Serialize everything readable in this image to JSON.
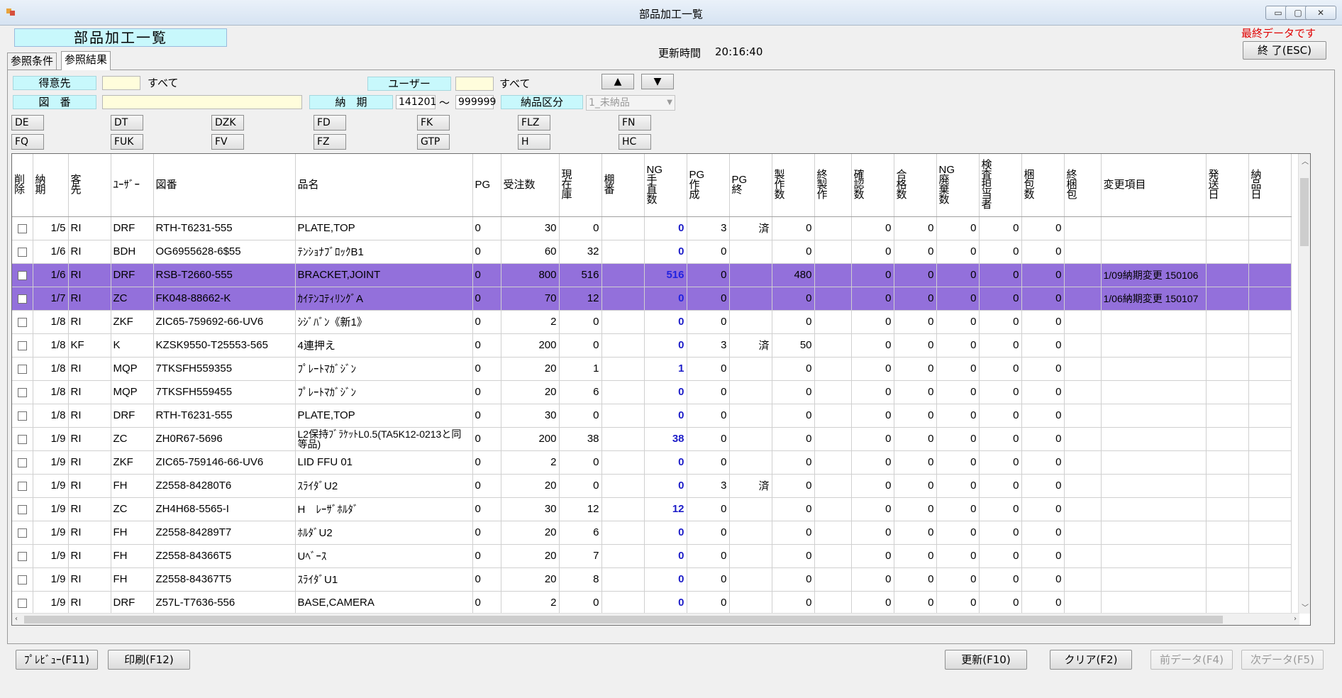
{
  "window": {
    "title": "部品加工一覧"
  },
  "header": {
    "label": "部品加工一覧",
    "update_label": "更新時間",
    "update_time": "20:16:40",
    "last_data": "最終データです",
    "exit_button": "終 了(ESC)"
  },
  "tabs": [
    "参照条件",
    "参照結果"
  ],
  "filters": {
    "customer_label": "得意先",
    "customer_value": "",
    "customer_all": "すべて",
    "user_label": "ユーザー",
    "user_value": "",
    "user_all": "すべて",
    "drawing_label": "図　番",
    "drawing_value": "",
    "due_label": "納　期",
    "due_from": "141201",
    "due_tilde": "～",
    "due_to": "999999",
    "delivery_label": "納品区分",
    "delivery_value": "1_未納品",
    "up_arrow": "▲",
    "down_arrow": "▼"
  },
  "codes_row1": [
    "DE",
    "DT",
    "DZK",
    "FD",
    "FK",
    "FLZ",
    "FN"
  ],
  "codes_row2": [
    "FQ",
    "FUK",
    "FV",
    "FZ",
    "GTP",
    "H",
    "HC"
  ],
  "table": {
    "columns": [
      "削\n除",
      "納\n期",
      "客\n先",
      "ﾕｰｻﾞｰ",
      "図番",
      "品名",
      "PG",
      "受注数",
      "現\n在\n庫",
      "棚\n番",
      "NG\n手\n直\n数",
      "PG\n作\n成",
      "PG\n終",
      "製\n作\n数",
      "終\n製\n作",
      "確\n認\n数",
      "合\n格\n数",
      "NG\n廃\n棄\n数",
      "検\n査\n担\n当\n者",
      "梱\n包\n数",
      "終\n梱\n包",
      "変更項目",
      "発\n送\n日",
      "納\n品\n日"
    ],
    "rows": [
      {
        "due": "1/5",
        "cust": "RI",
        "user": "DRF",
        "drawing": "RTH-T6231-555",
        "name": "PLATE,TOP",
        "pg": "0",
        "order": "30",
        "stock": "0",
        "shelf": "",
        "ng": "0",
        "pgmake": "3",
        "pgend": "済",
        "make": "0",
        "endmake": "",
        "confirm": "0",
        "pass": "0",
        "ngdisp": "0",
        "insp": "0",
        "pack": "0",
        "endpack": "",
        "change": "",
        "ship": "",
        "deliv": "",
        "hl": false
      },
      {
        "due": "1/6",
        "cust": "RI",
        "user": "BDH",
        "drawing": "OG6955628-6$55",
        "name": "ﾃﾝｼｮﾅﾌﾞﾛｯｸB1",
        "pg": "0",
        "order": "60",
        "stock": "32",
        "shelf": "",
        "ng": "0",
        "pgmake": "0",
        "pgend": "",
        "make": "0",
        "endmake": "",
        "confirm": "0",
        "pass": "0",
        "ngdisp": "0",
        "insp": "0",
        "pack": "0",
        "endpack": "",
        "change": "",
        "ship": "",
        "deliv": "",
        "hl": false
      },
      {
        "due": "1/6",
        "cust": "RI",
        "user": "DRF",
        "drawing": "RSB-T2660-555",
        "name": "BRACKET,JOINT",
        "pg": "0",
        "order": "800",
        "stock": "516",
        "shelf": "",
        "ng": "516",
        "pgmake": "0",
        "pgend": "",
        "make": "480",
        "endmake": "",
        "confirm": "0",
        "pass": "0",
        "ngdisp": "0",
        "insp": "0",
        "pack": "0",
        "endpack": "",
        "change": "1/09納期変更 150106",
        "ship": "",
        "deliv": "",
        "hl": true
      },
      {
        "due": "1/7",
        "cust": "RI",
        "user": "ZC",
        "drawing": "FK048-88662-K",
        "name": "ｶｲﾃﾝｺﾃｨﾘﾝｸﾞA",
        "pg": "0",
        "order": "70",
        "stock": "12",
        "shelf": "",
        "ng": "0",
        "pgmake": "0",
        "pgend": "",
        "make": "0",
        "endmake": "",
        "confirm": "0",
        "pass": "0",
        "ngdisp": "0",
        "insp": "0",
        "pack": "0",
        "endpack": "",
        "change": "1/06納期変更 150107",
        "ship": "",
        "deliv": "",
        "hl": true
      },
      {
        "due": "1/8",
        "cust": "RI",
        "user": "ZKF",
        "drawing": "ZIC65-759692-66-UV6",
        "name": "ｼｼﾞﾊﾞﾝ《新1》",
        "pg": "0",
        "order": "2",
        "stock": "0",
        "shelf": "",
        "ng": "0",
        "pgmake": "0",
        "pgend": "",
        "make": "0",
        "endmake": "",
        "confirm": "0",
        "pass": "0",
        "ngdisp": "0",
        "insp": "0",
        "pack": "0",
        "endpack": "",
        "change": "",
        "ship": "",
        "deliv": "",
        "hl": false
      },
      {
        "due": "1/8",
        "cust": "KF",
        "user": "K",
        "drawing": "KZSK9550-T25553-565",
        "name": "4連押え",
        "pg": "0",
        "order": "200",
        "stock": "0",
        "shelf": "",
        "ng": "0",
        "pgmake": "3",
        "pgend": "済",
        "make": "50",
        "endmake": "",
        "confirm": "0",
        "pass": "0",
        "ngdisp": "0",
        "insp": "0",
        "pack": "0",
        "endpack": "",
        "change": "",
        "ship": "",
        "deliv": "",
        "hl": false
      },
      {
        "due": "1/8",
        "cust": "RI",
        "user": "MQP",
        "drawing": "7TKSFH559355",
        "name": "ﾌﾟﾚｰﾄﾏｶﾞｼﾞﾝ",
        "pg": "0",
        "order": "20",
        "stock": "1",
        "shelf": "",
        "ng": "1",
        "pgmake": "0",
        "pgend": "",
        "make": "0",
        "endmake": "",
        "confirm": "0",
        "pass": "0",
        "ngdisp": "0",
        "insp": "0",
        "pack": "0",
        "endpack": "",
        "change": "",
        "ship": "",
        "deliv": "",
        "hl": false
      },
      {
        "due": "1/8",
        "cust": "RI",
        "user": "MQP",
        "drawing": "7TKSFH559455",
        "name": "ﾌﾟﾚｰﾄﾏｶﾞｼﾞﾝ",
        "pg": "0",
        "order": "20",
        "stock": "6",
        "shelf": "",
        "ng": "0",
        "pgmake": "0",
        "pgend": "",
        "make": "0",
        "endmake": "",
        "confirm": "0",
        "pass": "0",
        "ngdisp": "0",
        "insp": "0",
        "pack": "0",
        "endpack": "",
        "change": "",
        "ship": "",
        "deliv": "",
        "hl": false
      },
      {
        "due": "1/8",
        "cust": "RI",
        "user": "DRF",
        "drawing": "RTH-T6231-555",
        "name": "PLATE,TOP",
        "pg": "0",
        "order": "30",
        "stock": "0",
        "shelf": "",
        "ng": "0",
        "pgmake": "0",
        "pgend": "",
        "make": "0",
        "endmake": "",
        "confirm": "0",
        "pass": "0",
        "ngdisp": "0",
        "insp": "0",
        "pack": "0",
        "endpack": "",
        "change": "",
        "ship": "",
        "deliv": "",
        "hl": false
      },
      {
        "due": "1/9",
        "cust": "RI",
        "user": "ZC",
        "drawing": "ZH0R67-5696",
        "name": "L2保持ﾌﾞﾗｹｯﾄL0.5(TA5K12-0213と同等品)",
        "pg": "0",
        "order": "200",
        "stock": "38",
        "shelf": "",
        "ng": "38",
        "pgmake": "0",
        "pgend": "",
        "make": "0",
        "endmake": "",
        "confirm": "0",
        "pass": "0",
        "ngdisp": "0",
        "insp": "0",
        "pack": "0",
        "endpack": "",
        "change": "",
        "ship": "",
        "deliv": "",
        "hl": false,
        "wrapname": true
      },
      {
        "due": "1/9",
        "cust": "RI",
        "user": "ZKF",
        "drawing": "ZIC65-759146-66-UV6",
        "name": "LID FFU 01",
        "pg": "0",
        "order": "2",
        "stock": "0",
        "shelf": "",
        "ng": "0",
        "pgmake": "0",
        "pgend": "",
        "make": "0",
        "endmake": "",
        "confirm": "0",
        "pass": "0",
        "ngdisp": "0",
        "insp": "0",
        "pack": "0",
        "endpack": "",
        "change": "",
        "ship": "",
        "deliv": "",
        "hl": false
      },
      {
        "due": "1/9",
        "cust": "RI",
        "user": "FH",
        "drawing": "Z2558-84280T6",
        "name": "ｽﾗｲﾀﾞU2",
        "pg": "0",
        "order": "20",
        "stock": "0",
        "shelf": "",
        "ng": "0",
        "pgmake": "3",
        "pgend": "済",
        "make": "0",
        "endmake": "",
        "confirm": "0",
        "pass": "0",
        "ngdisp": "0",
        "insp": "0",
        "pack": "0",
        "endpack": "",
        "change": "",
        "ship": "",
        "deliv": "",
        "hl": false
      },
      {
        "due": "1/9",
        "cust": "RI",
        "user": "ZC",
        "drawing": "ZH4H68-5565-I",
        "name": "H　ﾚｰｻﾞﾎﾙﾀﾞ",
        "pg": "0",
        "order": "30",
        "stock": "12",
        "shelf": "",
        "ng": "12",
        "pgmake": "0",
        "pgend": "",
        "make": "0",
        "endmake": "",
        "confirm": "0",
        "pass": "0",
        "ngdisp": "0",
        "insp": "0",
        "pack": "0",
        "endpack": "",
        "change": "",
        "ship": "",
        "deliv": "",
        "hl": false
      },
      {
        "due": "1/9",
        "cust": "RI",
        "user": "FH",
        "drawing": "Z2558-84289T7",
        "name": "ﾎﾙﾀﾞU2",
        "pg": "0",
        "order": "20",
        "stock": "6",
        "shelf": "",
        "ng": "0",
        "pgmake": "0",
        "pgend": "",
        "make": "0",
        "endmake": "",
        "confirm": "0",
        "pass": "0",
        "ngdisp": "0",
        "insp": "0",
        "pack": "0",
        "endpack": "",
        "change": "",
        "ship": "",
        "deliv": "",
        "hl": false
      },
      {
        "due": "1/9",
        "cust": "RI",
        "user": "FH",
        "drawing": "Z2558-84366T5",
        "name": "Uﾍﾞｰｽ",
        "pg": "0",
        "order": "20",
        "stock": "7",
        "shelf": "",
        "ng": "0",
        "pgmake": "0",
        "pgend": "",
        "make": "0",
        "endmake": "",
        "confirm": "0",
        "pass": "0",
        "ngdisp": "0",
        "insp": "0",
        "pack": "0",
        "endpack": "",
        "change": "",
        "ship": "",
        "deliv": "",
        "hl": false
      },
      {
        "due": "1/9",
        "cust": "RI",
        "user": "FH",
        "drawing": "Z2558-84367T5",
        "name": "ｽﾗｲﾀﾞU1",
        "pg": "0",
        "order": "20",
        "stock": "8",
        "shelf": "",
        "ng": "0",
        "pgmake": "0",
        "pgend": "",
        "make": "0",
        "endmake": "",
        "confirm": "0",
        "pass": "0",
        "ngdisp": "0",
        "insp": "0",
        "pack": "0",
        "endpack": "",
        "change": "",
        "ship": "",
        "deliv": "",
        "hl": false
      },
      {
        "due": "1/9",
        "cust": "RI",
        "user": "DRF",
        "drawing": "Z57L-T7636-556",
        "name": "BASE,CAMERA",
        "pg": "0",
        "order": "2",
        "stock": "0",
        "shelf": "",
        "ng": "0",
        "pgmake": "0",
        "pgend": "",
        "make": "0",
        "endmake": "",
        "confirm": "0",
        "pass": "0",
        "ngdisp": "0",
        "insp": "0",
        "pack": "0",
        "endpack": "",
        "change": "",
        "ship": "",
        "deliv": "",
        "hl": false
      }
    ]
  },
  "footer": {
    "preview": "ﾌﾟﾚﾋﾞｭｰ(F11)",
    "print": "印刷(F12)",
    "refresh": "更新(F10)",
    "clear": "クリア(F2)",
    "prev": "前データ(F4)",
    "next": "次データ(F5)"
  },
  "colors": {
    "highlight_row": "#9370db",
    "label_bg": "#c8f8fc",
    "input_bg": "#fffddc",
    "ng_text": "#1c1cc8",
    "alert_text": "#e00000"
  }
}
